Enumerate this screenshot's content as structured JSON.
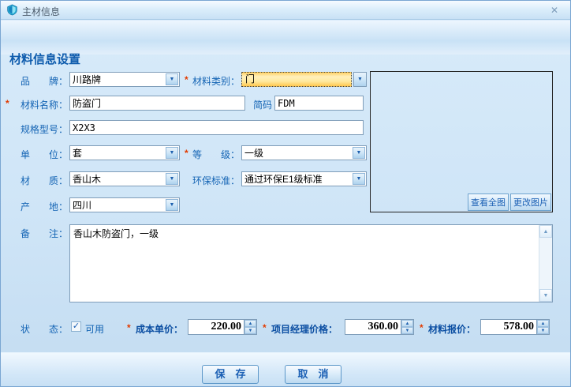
{
  "window": {
    "title": "主材信息"
  },
  "header": {
    "title": "材料信息设置"
  },
  "icons": {
    "close": "✕",
    "dropdown": "▼",
    "up": "▲",
    "down": "▼",
    "check": "✓"
  },
  "marks": {
    "required": "*"
  },
  "colors": {
    "accent_blue": "#1464b4",
    "focus_yellow": "#ffe99e",
    "required_red": "#e23b00"
  },
  "form": {
    "brand": {
      "label": "品　　牌：",
      "value": "川路牌"
    },
    "category": {
      "label": "材料类别：",
      "value": "门"
    },
    "name": {
      "label": "材料名称：",
      "value": "防盗门"
    },
    "shortcode": {
      "label": "简码",
      "value": "FDM"
    },
    "spec": {
      "label": "规格型号：",
      "value": "X2X3"
    },
    "unit": {
      "label": "单　　位：",
      "value": "套"
    },
    "grade": {
      "label": "等　　级：",
      "value": "一级"
    },
    "material": {
      "label": "材　　质：",
      "value": "香山木"
    },
    "env": {
      "label": "环保标准：",
      "value": "通过环保E1级标准"
    },
    "origin": {
      "label": "产　　地：",
      "value": "四川"
    },
    "remarks": {
      "label": "备　　注：",
      "value": "香山木防盗门，一级"
    },
    "status": {
      "label": "状　　态：",
      "option": "可用"
    },
    "cost": {
      "label": "成本单价：",
      "value": "220.00"
    },
    "pm_price": {
      "label": "项目经理价格：",
      "value": "360.00"
    },
    "quote": {
      "label": "材料报价：",
      "value": "578.00"
    }
  },
  "image_panel": {
    "view_full": "查看全图",
    "change": "更改图片"
  },
  "actions": {
    "save": "保　存",
    "cancel": "取　消"
  }
}
